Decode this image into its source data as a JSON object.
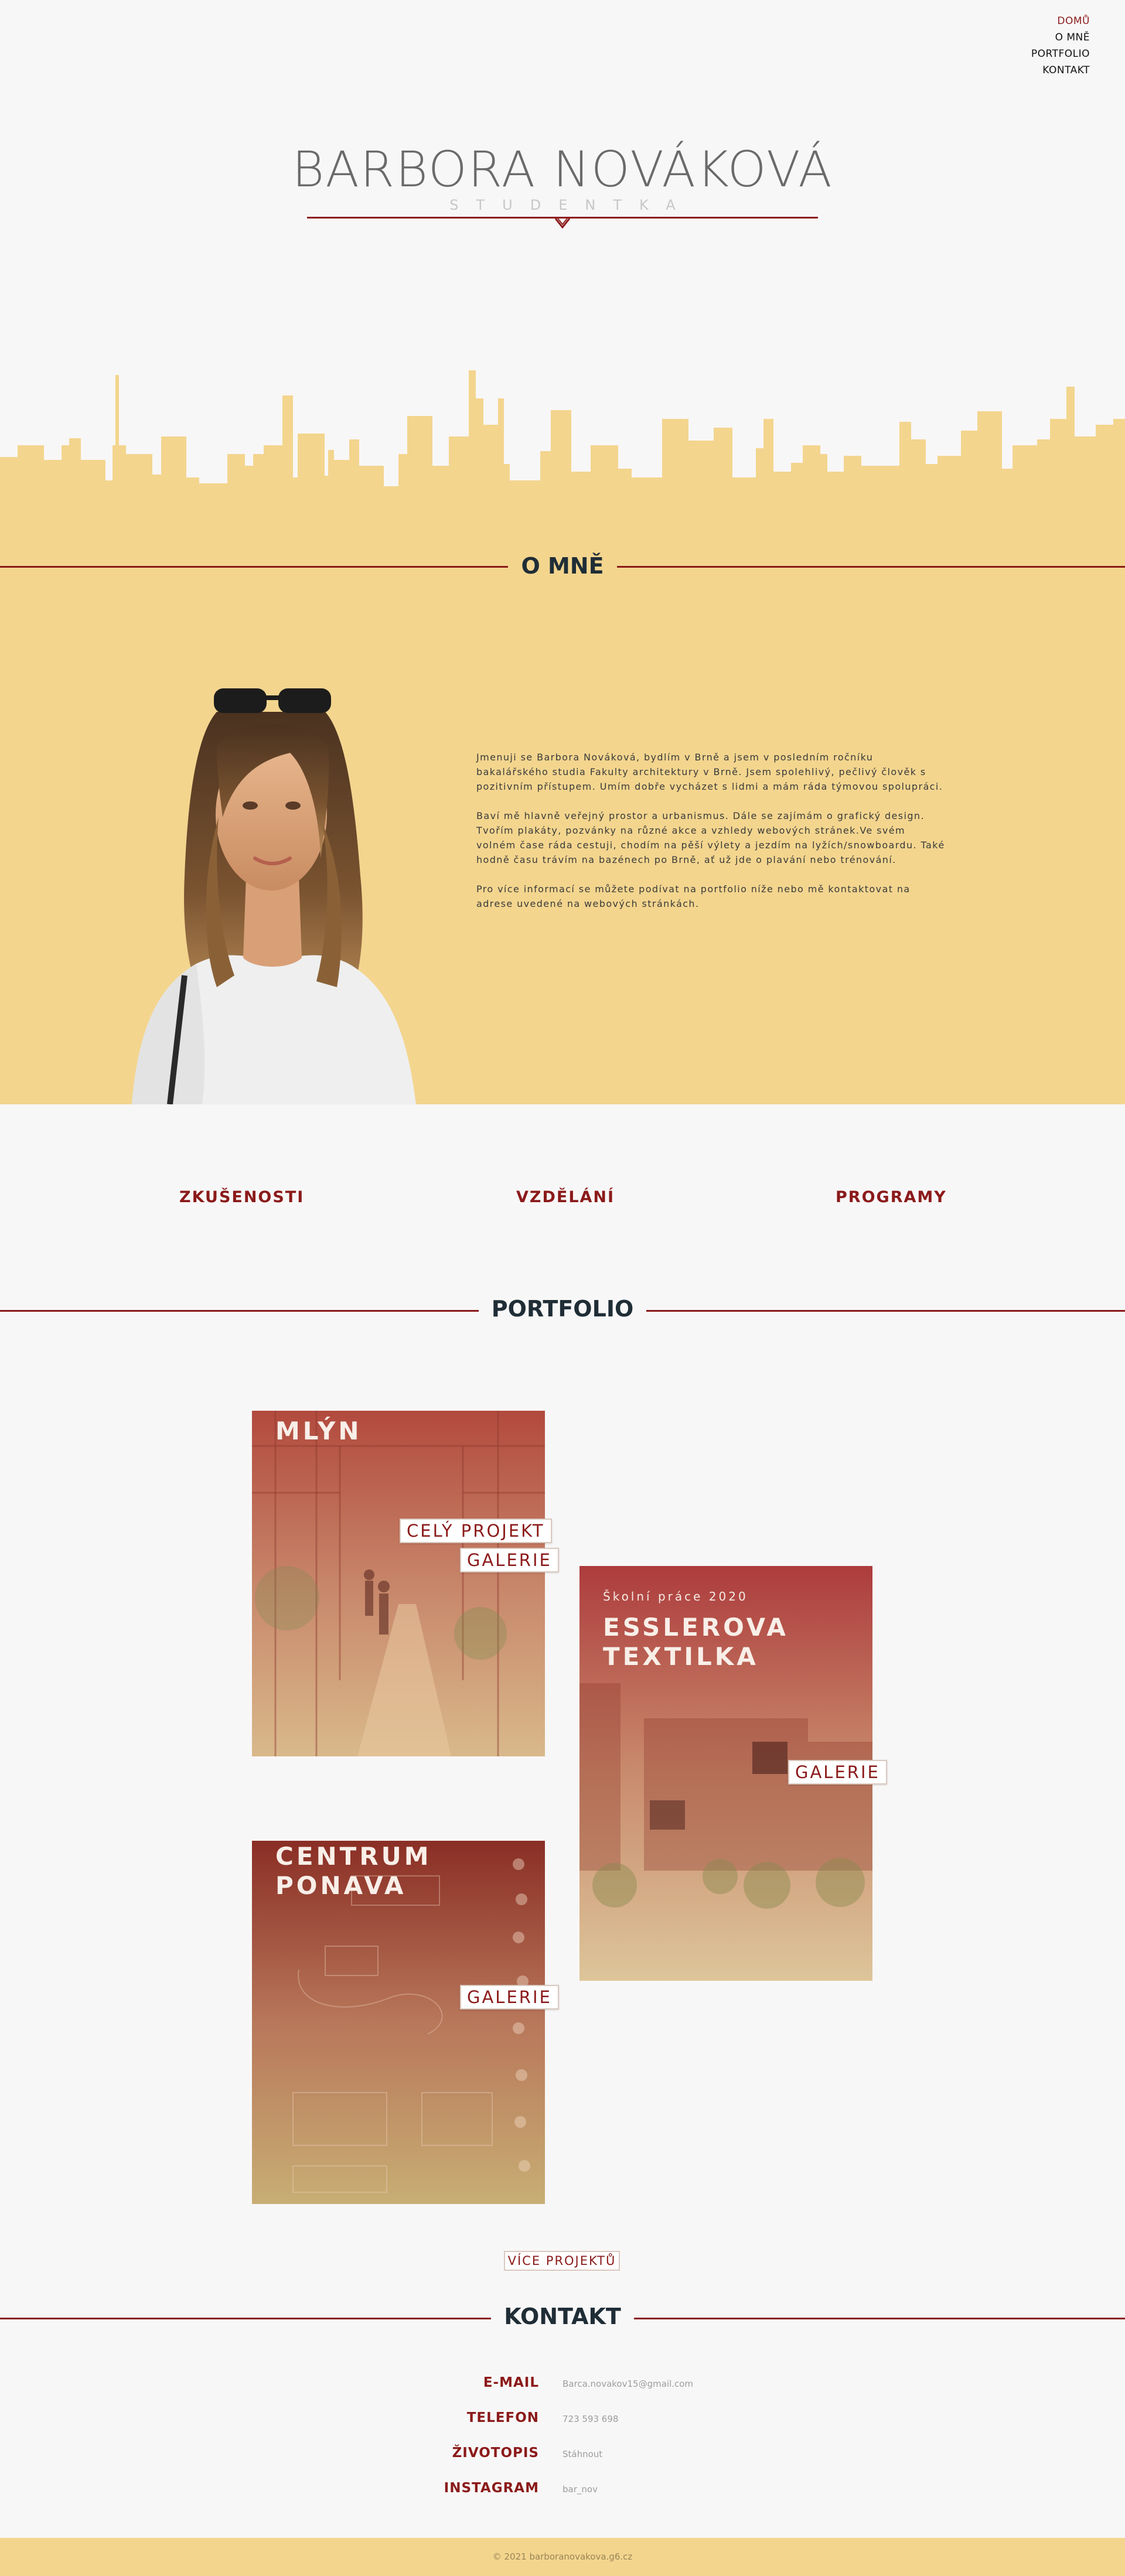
{
  "nav": {
    "items": [
      {
        "label": "DOMŮ"
      },
      {
        "label": "O MNĚ"
      },
      {
        "label": "PORTFOLIO"
      },
      {
        "label": "KONTAKT"
      }
    ]
  },
  "hero": {
    "title": "BARBORA NOVÁKOVÁ",
    "subtitle": "STUDENTKA"
  },
  "about": {
    "title": "O MNĚ",
    "paragraphs": [
      "Jmenuji se Barbora Nováková, bydlím v Brně a jsem v posledním ročníku bakalářského studia Fakulty architektury v Brně. Jsem spolehlivý, pečlivý člověk s pozitivním přístupem. Umím dobře vycházet s lidmi a mám ráda týmovou spolupráci.",
      "Baví mě hlavně veřejný prostor a urbanismus. Dále se zajímám o grafický design. Tvořím plakáty, pozvánky na různé akce a vzhledy webových stránek.Ve svém volném čase ráda cestuji, chodím na pěší výlety a jezdím na lyžích/snowboardu. Také hodně času trávím na bazénech po Brně, ať už jde o plavání nebo trénování.",
      "Pro více informací se můžete podívat na portfolio níže nebo mě kontaktovat na adrese uvedené na webových stránkách."
    ]
  },
  "sublinks": {
    "experience": "ZKUŠENOSTI",
    "education": "VZDĚLÁNÍ",
    "programs": "PROGRAMY"
  },
  "portfolio": {
    "title": "PORTFOLIO",
    "cards": [
      {
        "title": "MLÝN",
        "buttons": [
          "CELÝ PROJEKT",
          "GALERIE"
        ]
      },
      {
        "subtitle": "Školní práce 2020",
        "title_lines": [
          "ESSLEROVA",
          "TEXTILKA"
        ],
        "buttons": [
          "GALERIE"
        ]
      },
      {
        "title_lines": [
          "CENTRUM",
          "PONAVA"
        ],
        "buttons": [
          "GALERIE"
        ]
      }
    ],
    "more_button": "VÍCE PROJEKTŮ"
  },
  "contact": {
    "title": "KONTAKT",
    "rows": [
      {
        "label": "E-MAIL",
        "value": "Barca.novakov15@gmail.com"
      },
      {
        "label": "TELEFON",
        "value": "723 593 698"
      },
      {
        "label": "ŽIVOTOPIS",
        "value": "Stáhnout"
      },
      {
        "label": "INSTAGRAM",
        "value": "bar_nov"
      }
    ]
  },
  "footer": {
    "text": "© 2021 barboranovakova.g6.cz"
  },
  "colors": {
    "accent": "#8b1a1a",
    "sand": "#f3d58e",
    "heading": "#1f2d36",
    "background": "#f8f7f7"
  }
}
